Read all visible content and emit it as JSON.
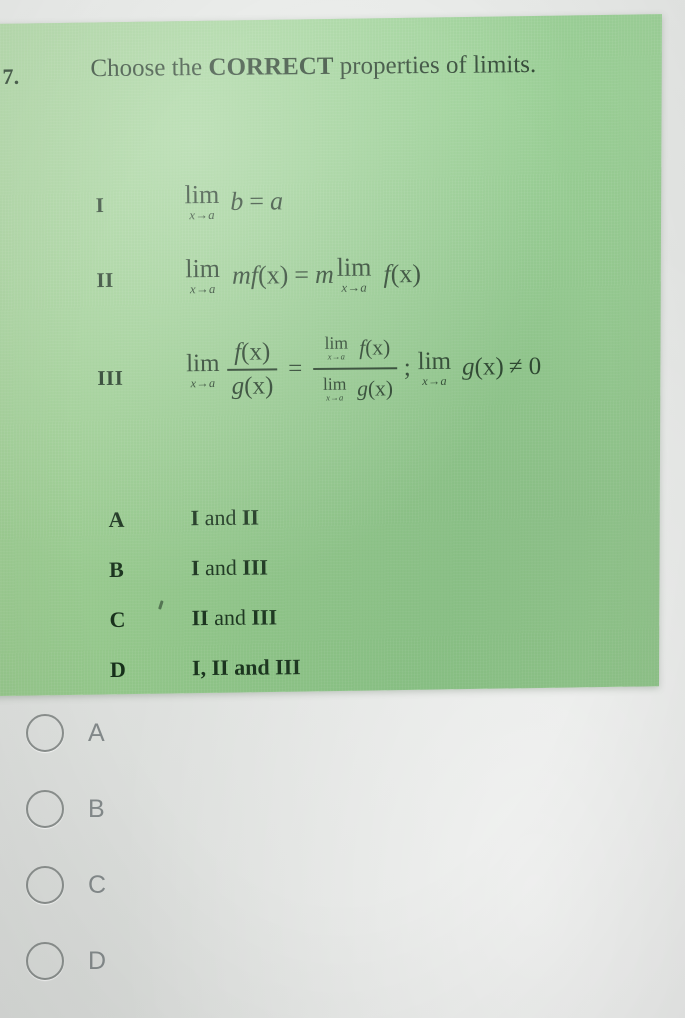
{
  "card": {
    "question_number": "7.",
    "stem_prefix": "Choose the ",
    "stem_bold": "CORRECT",
    "stem_suffix": " properties of limits.",
    "background_color": "#93cd8c",
    "text_color": "#16301a"
  },
  "statements": [
    {
      "label": "I",
      "plain": "lim x→a b = a",
      "lim1_op": "lim",
      "lim1_sub": "x→a",
      "rhs": "b = a",
      "var_b": "b",
      "equals": "=",
      "var_a": "a"
    },
    {
      "label": "II",
      "plain": "lim x→a mf(x) = m lim x→a f(x)",
      "lim1_op": "lim",
      "lim1_sub": "x→a",
      "left_expr": "mf",
      "left_arg": "(x)",
      "equals": "=",
      "coef": "m",
      "lim2_op": "lim",
      "lim2_sub": "x→a",
      "right_expr": "f",
      "right_arg": "(x)"
    },
    {
      "label": "III",
      "plain": "lim x→a f(x)/g(x) = [lim x→a f(x)] / [lim x→a g(x)] ; lim x→a g(x) ≠ 0",
      "lim1_op": "lim",
      "lim1_sub": "x→a",
      "num_left": "f",
      "num_left_arg": "(x)",
      "den_left": "g",
      "den_left_arg": "(x)",
      "equals": "=",
      "lim_num_op": "lim",
      "lim_num_sub": "x→a",
      "num_right": "f",
      "num_right_arg": "(x)",
      "lim_den_op": "lim",
      "lim_den_sub": "x→a",
      "den_right": "g",
      "den_right_arg": "(x)",
      "separator": ";",
      "cond_lim_op": "lim",
      "cond_lim_sub": "x→a",
      "cond_fn": "g",
      "cond_arg": "(x)",
      "cond_rel": "≠ 0"
    }
  ],
  "printed_options": [
    {
      "letter": "A",
      "text": "I and II",
      "roman1": "I",
      "conj": " and ",
      "roman2": "II"
    },
    {
      "letter": "B",
      "text": "I and III",
      "roman1": "I",
      "conj": " and ",
      "roman2": "III"
    },
    {
      "letter": "C",
      "text": "II and III",
      "roman1": "II",
      "conj": " and ",
      "roman2": "III"
    },
    {
      "letter": "D",
      "text": "I, II and III",
      "roman1": "I,",
      "conj": " II and ",
      "roman2": "III"
    }
  ],
  "answer_choices": {
    "selected": "",
    "items": [
      {
        "value": "A",
        "label": "A",
        "selected": false
      },
      {
        "value": "B",
        "label": "B",
        "selected": false
      },
      {
        "value": "C",
        "label": "C",
        "selected": false
      },
      {
        "value": "D",
        "label": "D",
        "selected": false
      }
    ],
    "radio_border_color": "#8a8f8d",
    "label_color": "#83898a",
    "background_color": "#e6e8e6"
  }
}
